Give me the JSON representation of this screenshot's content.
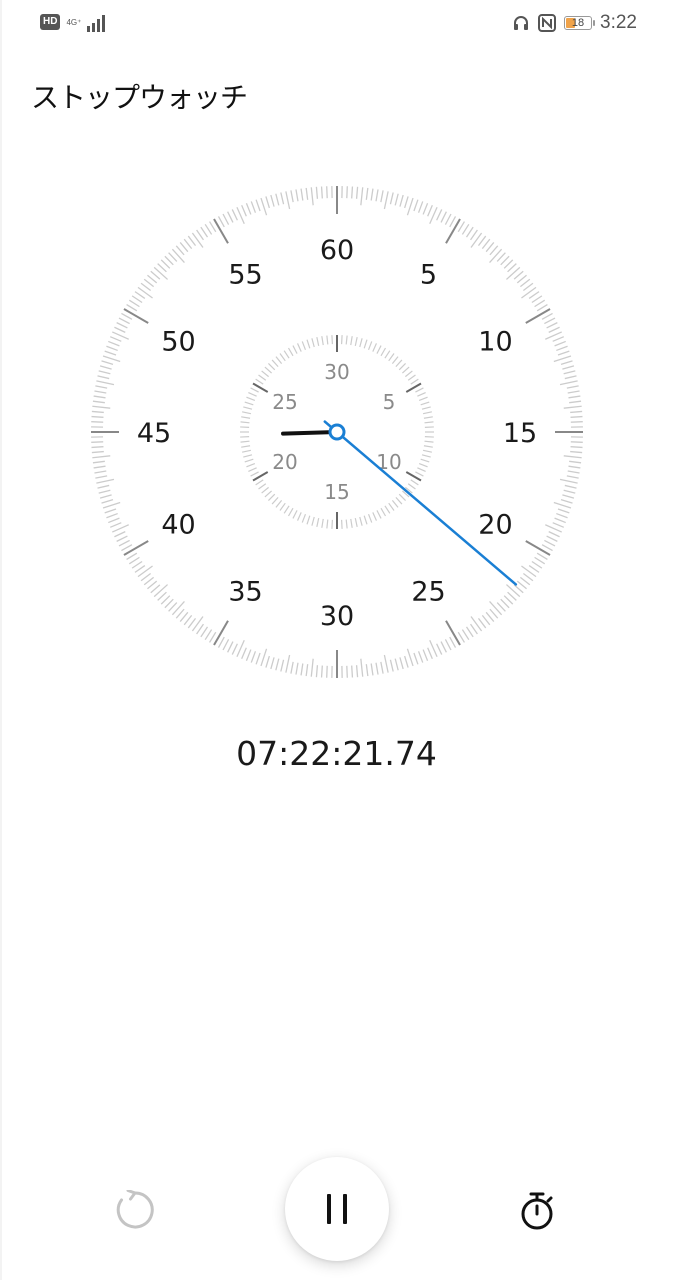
{
  "status_bar": {
    "hd_label": "HD",
    "network_label": "4G⁺",
    "battery_level": "18",
    "time": "3:22",
    "icons": [
      "headset-icon",
      "nfc-icon",
      "battery-icon"
    ]
  },
  "app": {
    "title": "ストップウォッチ"
  },
  "dial": {
    "outer_labels": [
      "60",
      "5",
      "10",
      "15",
      "20",
      "25",
      "30",
      "35",
      "40",
      "45",
      "50",
      "55"
    ],
    "inner_labels": [
      "30",
      "5",
      "10",
      "15",
      "20",
      "25"
    ],
    "seconds_hand_value": 21.74,
    "minutes_hand_value": 22.36,
    "accent_color": "#1a7fd4",
    "tick_color": "#cccccc"
  },
  "elapsed_time": "07:22:21.74",
  "controls": {
    "reset_icon": "reset-icon",
    "pause_icon": "pause-icon",
    "lap_icon": "stopwatch-icon"
  }
}
